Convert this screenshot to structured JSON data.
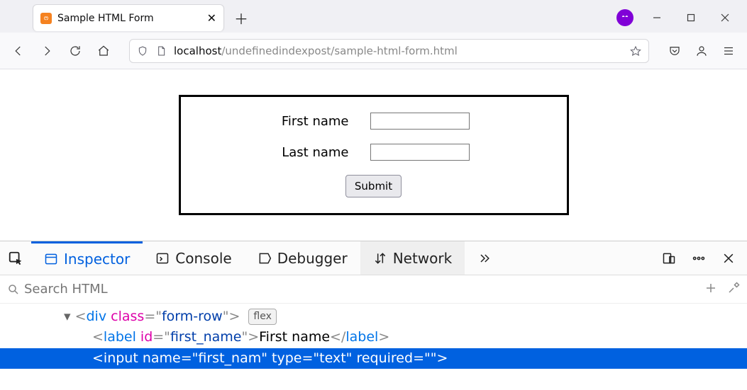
{
  "browser": {
    "tab_title": "Sample HTML Form",
    "url_host": "localhost",
    "url_path": "/undefinedindexpost/sample-html-form.html"
  },
  "form": {
    "first_name_label": "First name",
    "last_name_label": "Last name",
    "submit_label": "Submit"
  },
  "devtools": {
    "tabs": {
      "inspector": "Inspector",
      "console": "Console",
      "debugger": "Debugger",
      "network": "Network"
    },
    "search_placeholder": "Search HTML",
    "flex_pill": "flex",
    "markup": {
      "line1": {
        "tag": "div",
        "class_attr": "class",
        "class_val": "form-row"
      },
      "line2": {
        "tag": "label",
        "id_attr": "id",
        "id_val": "first_name",
        "text": "First name"
      },
      "line3": {
        "tag": "input",
        "name_attr": "name",
        "name_val": "first_nam",
        "type_attr": "type",
        "type_val": "text",
        "required_attr": "required",
        "required_val": ""
      }
    }
  }
}
